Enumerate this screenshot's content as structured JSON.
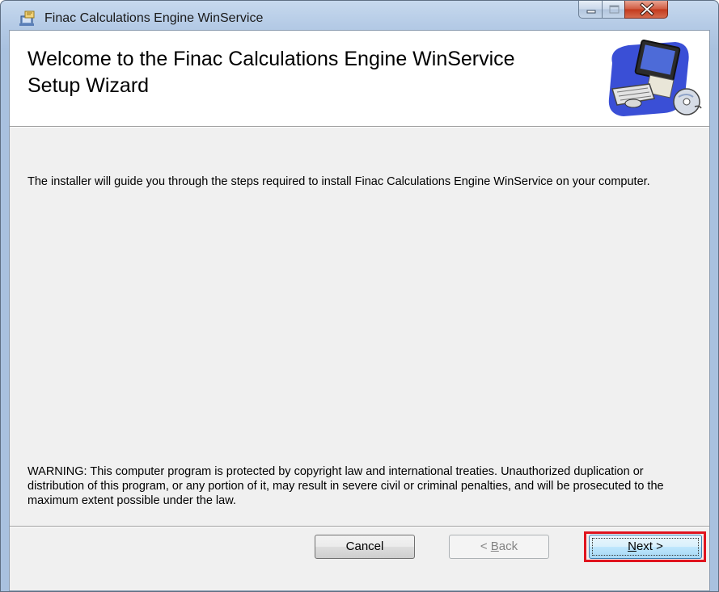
{
  "window": {
    "title": "Finac Calculations Engine WinService",
    "app_icon": "installer-icon"
  },
  "caption_buttons": {
    "minimize_icon": "minimize-icon",
    "maximize_icon": "maximize-icon",
    "close_icon": "close-icon"
  },
  "banner": {
    "title": "Welcome to the Finac Calculations Engine WinService Setup Wizard",
    "art_icon": "computer-setup-icon"
  },
  "content": {
    "intro": "The installer will guide you through the steps required to install Finac Calculations Engine WinService on your computer.",
    "warning": "WARNING: This computer program is protected by copyright law and international treaties. Unauthorized duplication or distribution of this program, or any portion of it, may result in severe civil or criminal penalties, and will be prosecuted to the maximum extent possible under the law."
  },
  "buttons": {
    "cancel": "Cancel",
    "back_prefix": "< ",
    "back_accel": "B",
    "back_rest": "ack",
    "next_accel": "N",
    "next_rest": "ext >"
  },
  "colors": {
    "highlight": "#e0141e",
    "close_button": "#c2391c"
  }
}
